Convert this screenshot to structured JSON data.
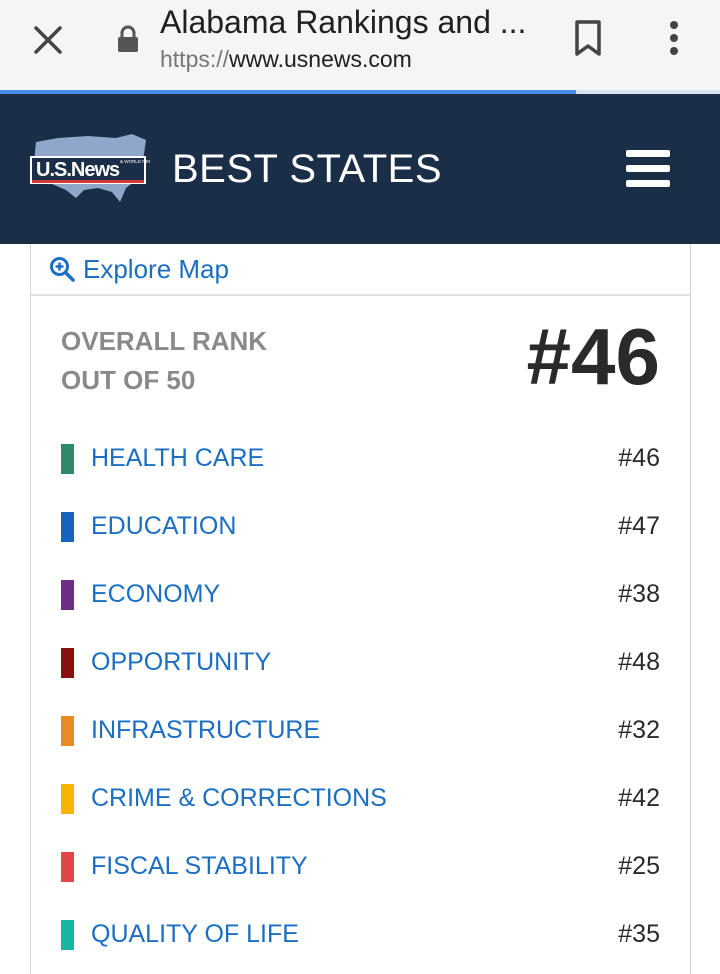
{
  "browser": {
    "tab_title": "Alabama Rankings and ...",
    "url_scheme": "https://",
    "url_host": "www.usnews.com",
    "close_icon": "close-icon",
    "lock_icon": "lock-icon",
    "bookmark_icon": "bookmark-icon",
    "menu_icon": "more-vert-icon",
    "load_progress": 0.8
  },
  "header": {
    "logo_text": "U.S.News",
    "logo_subtext": "& WORLD REPORT",
    "section_title": "BEST STATES",
    "menu_icon": "hamburger-menu-icon",
    "background": "#1b2e48"
  },
  "card": {
    "explore_icon": "zoom-in-icon",
    "explore_label": "Explore Map",
    "overall_label_line1": "OVERALL RANK",
    "overall_label_line2": "OUT OF 50",
    "overall_rank": "#46",
    "categories": [
      {
        "name": "HEALTH CARE",
        "rank": "#46",
        "color": "#2e8a6b"
      },
      {
        "name": "EDUCATION",
        "rank": "#47",
        "color": "#1565c0"
      },
      {
        "name": "ECONOMY",
        "rank": "#38",
        "color": "#6d2e84"
      },
      {
        "name": "OPPORTUNITY",
        "rank": "#48",
        "color": "#8a0f0f"
      },
      {
        "name": "INFRASTRUCTURE",
        "rank": "#32",
        "color": "#e88a25"
      },
      {
        "name": "CRIME & CORRECTIONS",
        "rank": "#42",
        "color": "#f7b500"
      },
      {
        "name": "FISCAL STABILITY",
        "rank": "#25",
        "color": "#e04848"
      },
      {
        "name": "QUALITY OF LIFE",
        "rank": "#35",
        "color": "#17b79f"
      }
    ]
  },
  "colors": {
    "link": "#1b6ec2",
    "muted": "#8a8a8a",
    "dark_text": "#2a2a2a"
  }
}
